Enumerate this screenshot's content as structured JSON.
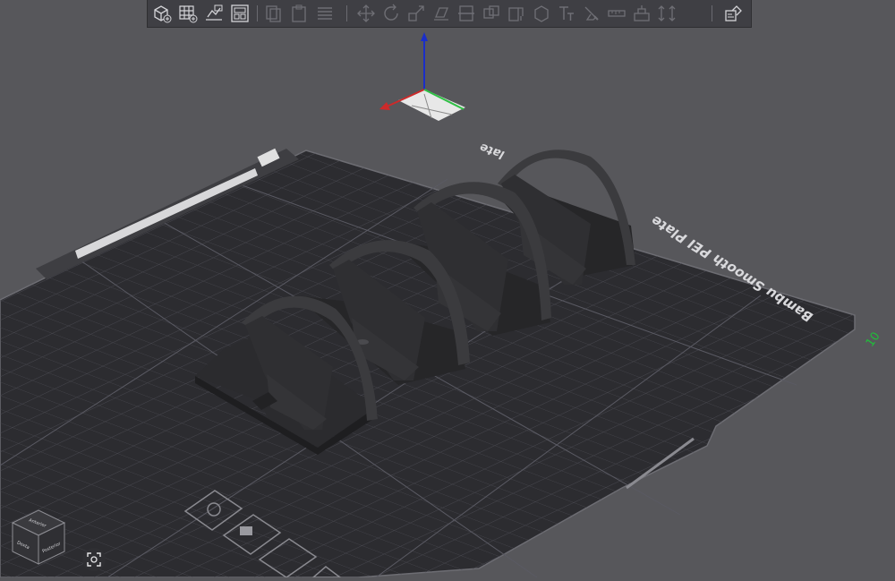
{
  "toolbar": {
    "buttons": [
      {
        "name": "add-object-button",
        "icon": "cube-plus-icon",
        "enabled": true
      },
      {
        "name": "add-plate-button",
        "icon": "grid-plus-icon",
        "enabled": true
      },
      {
        "name": "auto-orient-button",
        "icon": "auto-orient-icon",
        "enabled": true
      },
      {
        "name": "arrange-button",
        "icon": "arrange-icon",
        "enabled": true
      },
      {
        "name": "copy-button",
        "icon": "copy-icon",
        "enabled": false
      },
      {
        "name": "paste-button",
        "icon": "paste-icon",
        "enabled": false
      },
      {
        "name": "layers-button",
        "icon": "layers-icon",
        "enabled": false
      },
      {
        "name": "move-button",
        "icon": "move-icon",
        "enabled": false
      },
      {
        "name": "rotate-button",
        "icon": "rotate-icon",
        "enabled": false
      },
      {
        "name": "scale-button",
        "icon": "scale-icon",
        "enabled": false
      },
      {
        "name": "lay-on-face-button",
        "icon": "lay-on-face-icon",
        "enabled": false
      },
      {
        "name": "cut-button",
        "icon": "cut-icon",
        "enabled": false
      },
      {
        "name": "mesh-boolean-button",
        "icon": "boolean-icon",
        "enabled": false
      },
      {
        "name": "support-paint-button",
        "icon": "support-paint-icon",
        "enabled": false
      },
      {
        "name": "seam-paint-button",
        "icon": "seam-paint-icon",
        "enabled": false
      },
      {
        "name": "text-button",
        "icon": "text-icon",
        "enabled": false
      },
      {
        "name": "color-paint-button",
        "icon": "color-paint-icon",
        "enabled": false
      },
      {
        "name": "measure-button",
        "icon": "measure-icon",
        "enabled": false
      },
      {
        "name": "assembly-button",
        "icon": "assembly-icon",
        "enabled": false
      },
      {
        "name": "fit-height-button",
        "icon": "fit-height-icon",
        "enabled": false
      },
      {
        "name": "variable-layer-button",
        "icon": "variable-layer-icon",
        "enabled": true
      }
    ]
  },
  "bed": {
    "plate_label": "Bambu Smooth PEI Plate",
    "plate_label_top": "late",
    "plate_number": "10",
    "colors": {
      "bed": "#2d2d31",
      "grid": "#505058",
      "border": "#6e6e74",
      "background": "#57575b"
    }
  },
  "axes": {
    "x_color": "#cc2a2a",
    "y_color": "#2fbf45",
    "z_color": "#1a2ec8"
  },
  "objects": {
    "count": 4,
    "color": "#2f2f32",
    "description": "quarter-round bracket"
  },
  "view_cube": {
    "faces": [
      "Anterior",
      "Dexta",
      "Posterior"
    ]
  },
  "plate_tools": [
    "plate-settings-icon",
    "plate-lock-icon",
    "plate-arrange-icon",
    "plate-orient-icon"
  ]
}
